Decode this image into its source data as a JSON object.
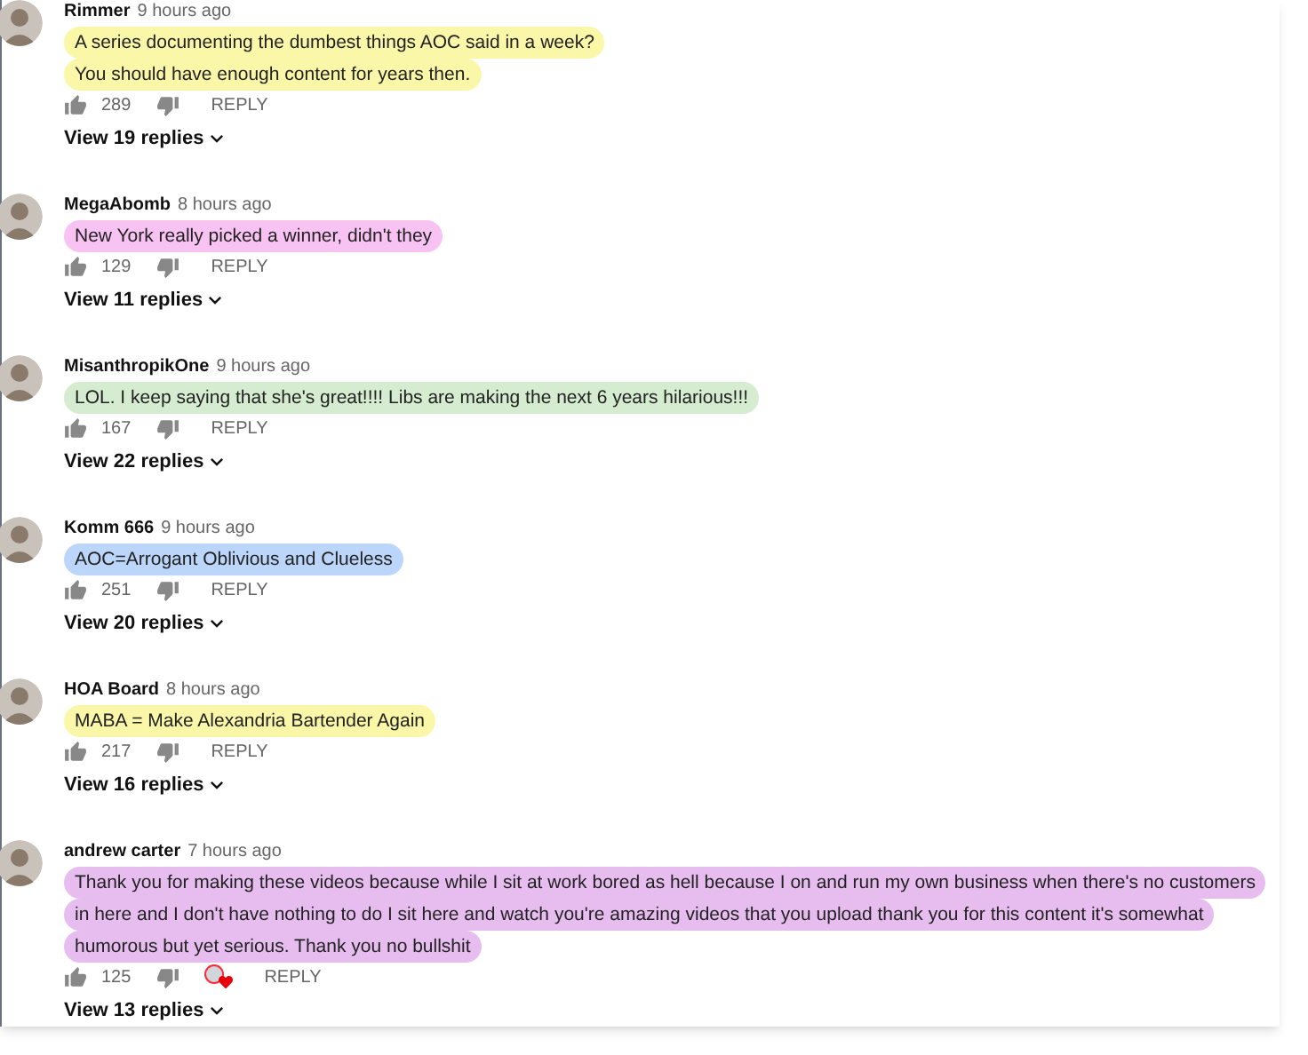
{
  "comments": [
    {
      "author": "Rimmer",
      "time": "9 hours ago",
      "text_lines": [
        "A series documenting the dumbest things AOC said in a week?",
        "You should have enough content for years then."
      ],
      "color": "#fbf7a8",
      "likes": "289",
      "hearted": false,
      "reply_label": "REPLY",
      "view_replies": "View 19 replies"
    },
    {
      "author": "MegaAbomb",
      "time": "8 hours ago",
      "text_lines": [
        "New York really picked a winner, didn't they"
      ],
      "color": "#f8c2f3",
      "likes": "129",
      "hearted": false,
      "reply_label": "REPLY",
      "view_replies": "View 11 replies"
    },
    {
      "author": "MisanthropikOne",
      "time": "9 hours ago",
      "text_lines": [
        "LOL. I keep saying that she's great!!!! Libs are making the next 6 years hilarious!!!"
      ],
      "color": "#d5ecd0",
      "likes": "167",
      "hearted": false,
      "reply_label": "REPLY",
      "view_replies": "View 22 replies"
    },
    {
      "author": "Komm 666",
      "time": "9 hours ago",
      "text_lines": [
        "AOC=Arrogant Oblivious and Clueless"
      ],
      "color": "#bcd6fb",
      "likes": "251",
      "hearted": false,
      "reply_label": "REPLY",
      "view_replies": "View 20 replies"
    },
    {
      "author": "HOA Board",
      "time": "8 hours ago",
      "text_lines": [
        "MABA = Make Alexandria Bartender Again"
      ],
      "color": "#fbf7a8",
      "likes": "217",
      "hearted": false,
      "reply_label": "REPLY",
      "view_replies": "View 16 replies"
    },
    {
      "author": "andrew carter",
      "time": "7 hours ago",
      "text_lines": [
        "Thank you for making these videos because while I sit at work bored as hell because I on and run my own business when there's no customers",
        "in here and I don't have nothing to do I sit here and watch you're amazing videos that you upload thank you for this content it's somewhat",
        "humorous but yet serious. Thank you no bullshit"
      ],
      "color": "#e7bdf0",
      "likes": "125",
      "hearted": true,
      "reply_label": "REPLY",
      "view_replies": "View 13 replies"
    }
  ]
}
